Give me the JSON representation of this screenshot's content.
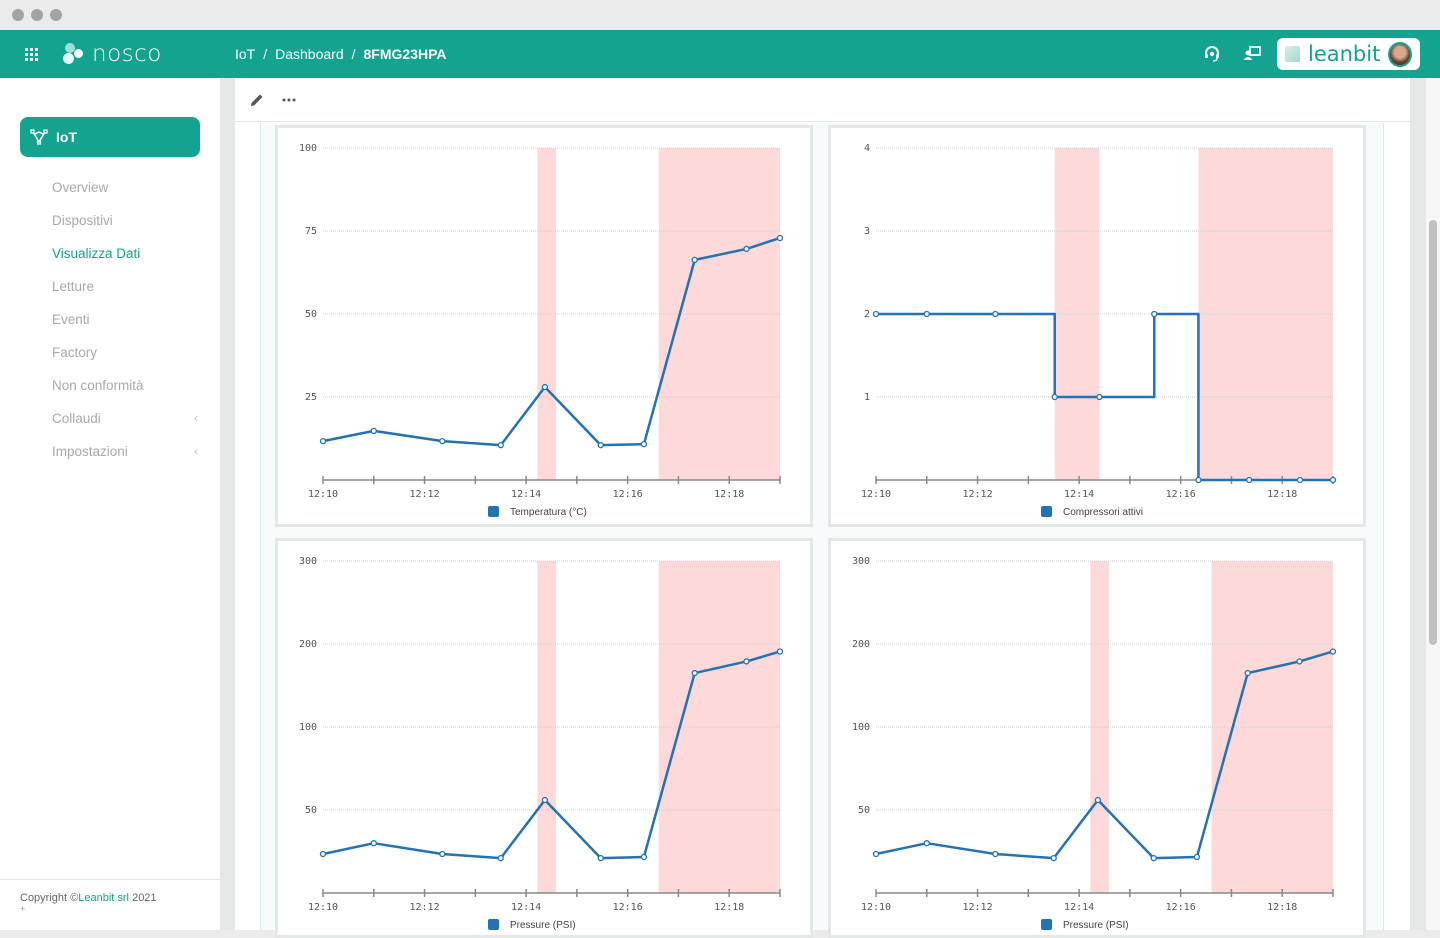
{
  "window": {
    "controls": [
      "close",
      "minimize",
      "maximize"
    ]
  },
  "header": {
    "app_name": "nosco",
    "breadcrumb": [
      "IoT",
      "Dashboard",
      "8FMG23HPA"
    ],
    "separator": "/",
    "icons": [
      "apps-grid-icon",
      "headset-icon",
      "remote-desktop-icon"
    ],
    "brand": "leanbit",
    "colors": {
      "primary": "#13a38f",
      "accent_line": "#2272b4",
      "alarm_band": "#fdd9d9"
    }
  },
  "sidebar": {
    "section": {
      "label": "IoT",
      "icon": "iot-network-icon"
    },
    "items": [
      {
        "label": "Overview",
        "active": false,
        "expandable": false
      },
      {
        "label": "Dispositivi",
        "active": false,
        "expandable": false
      },
      {
        "label": "Visualizza Dati",
        "active": true,
        "expandable": false
      },
      {
        "label": "Letture",
        "active": false,
        "expandable": false
      },
      {
        "label": "Eventi",
        "active": false,
        "expandable": false
      },
      {
        "label": "Factory",
        "active": false,
        "expandable": false
      },
      {
        "label": "Non conformità",
        "active": false,
        "expandable": false
      },
      {
        "label": "Collaudi",
        "active": false,
        "expandable": true
      },
      {
        "label": "Impostazioni",
        "active": false,
        "expandable": true
      }
    ],
    "expand_glyph": "‹",
    "footer": {
      "prefix": "Copyright ©",
      "link": "Leanbit srl",
      "suffix": " 2021",
      "extra": "+"
    }
  },
  "toolbar": {
    "edit_icon": "pencil-icon",
    "more_icon": "more-horizontal-icon"
  },
  "chart_data": [
    {
      "type": "line",
      "title": "",
      "legend": "Temperatura (°C)",
      "legend_position": "bottom",
      "x_unit": "minutes after 12:00",
      "xlim": [
        10,
        19
      ],
      "xticks": [
        "12:10",
        "12:12",
        "12:14",
        "12:16",
        "12:18"
      ],
      "ylim": [
        0,
        100
      ],
      "yticks": [
        0,
        25,
        50,
        75,
        100
      ],
      "ytick_labels": [
        "",
        "25",
        "50",
        "75",
        "100"
      ],
      "grid": true,
      "step": false,
      "x": [
        10.0,
        11.0,
        12.35,
        13.5,
        14.37,
        15.47,
        16.32,
        17.32,
        18.34,
        19.0
      ],
      "values": [
        11.7,
        14.8,
        11.7,
        10.5,
        28.0,
        10.5,
        10.8,
        66.3,
        69.6,
        72.9
      ],
      "alarm_bands": [
        [
          14.22,
          14.59
        ],
        [
          16.61,
          19.0
        ]
      ]
    },
    {
      "type": "line",
      "title": "",
      "legend": "Compressori attivi",
      "legend_position": "bottom",
      "x_unit": "minutes after 12:00",
      "xlim": [
        10,
        19
      ],
      "xticks": [
        "12:10",
        "12:12",
        "12:14",
        "12:16",
        "12:18"
      ],
      "ylim": [
        0,
        4
      ],
      "yticks": [
        0,
        1,
        2,
        3,
        4
      ],
      "ytick_labels": [
        "",
        "1",
        "2",
        "3",
        "4"
      ],
      "grid": true,
      "step": true,
      "x": [
        10.0,
        11.0,
        12.35,
        13.52,
        14.4,
        15.48,
        16.35,
        17.35,
        18.35,
        19.0
      ],
      "values": [
        2,
        2,
        2,
        1,
        1,
        2,
        0,
        0,
        0,
        0
      ],
      "alarm_bands": [
        [
          13.52,
          14.4
        ],
        [
          16.35,
          19.0
        ]
      ]
    },
    {
      "type": "line",
      "title": "",
      "legend": "Pressure (PSI)",
      "legend_position": "bottom",
      "x_unit": "minutes after 12:00",
      "xlim": [
        10,
        19
      ],
      "xticks": [
        "12:10",
        "12:12",
        "12:14",
        "12:16",
        "12:18"
      ],
      "ylim": [
        0,
        300
      ],
      "yticks": [
        0,
        50,
        100,
        200,
        300
      ],
      "ytick_labels": [
        "",
        "50",
        "100",
        "200",
        "300"
      ],
      "y_scale": "piecewise (equal spacing between ticks)",
      "grid": true,
      "step": false,
      "x": [
        10.0,
        11.0,
        12.35,
        13.5,
        14.37,
        15.47,
        16.32,
        17.32,
        18.34,
        19.0
      ],
      "values": [
        23.5,
        30.0,
        23.5,
        21.0,
        56.0,
        21.0,
        21.7,
        165.0,
        179.0,
        191.0
      ],
      "alarm_bands": [
        [
          14.22,
          14.59
        ],
        [
          16.61,
          19.0
        ]
      ]
    },
    {
      "type": "line",
      "title": "",
      "legend": "Pressure (PSI)",
      "legend_position": "bottom",
      "x_unit": "minutes after 12:00",
      "xlim": [
        10,
        19
      ],
      "xticks": [
        "12:10",
        "12:12",
        "12:14",
        "12:16",
        "12:18"
      ],
      "ylim": [
        0,
        300
      ],
      "yticks": [
        0,
        50,
        100,
        200,
        300
      ],
      "ytick_labels": [
        "",
        "50",
        "100",
        "200",
        "300"
      ],
      "y_scale": "piecewise (equal spacing between ticks)",
      "grid": true,
      "step": false,
      "x": [
        10.0,
        11.0,
        12.35,
        13.5,
        14.37,
        15.47,
        16.32,
        17.32,
        18.34,
        19.0
      ],
      "values": [
        23.5,
        30.0,
        23.5,
        21.0,
        56.0,
        21.0,
        21.7,
        165.0,
        179.0,
        191.0
      ],
      "alarm_bands": [
        [
          14.22,
          14.59
        ],
        [
          16.61,
          19.0
        ]
      ]
    }
  ]
}
